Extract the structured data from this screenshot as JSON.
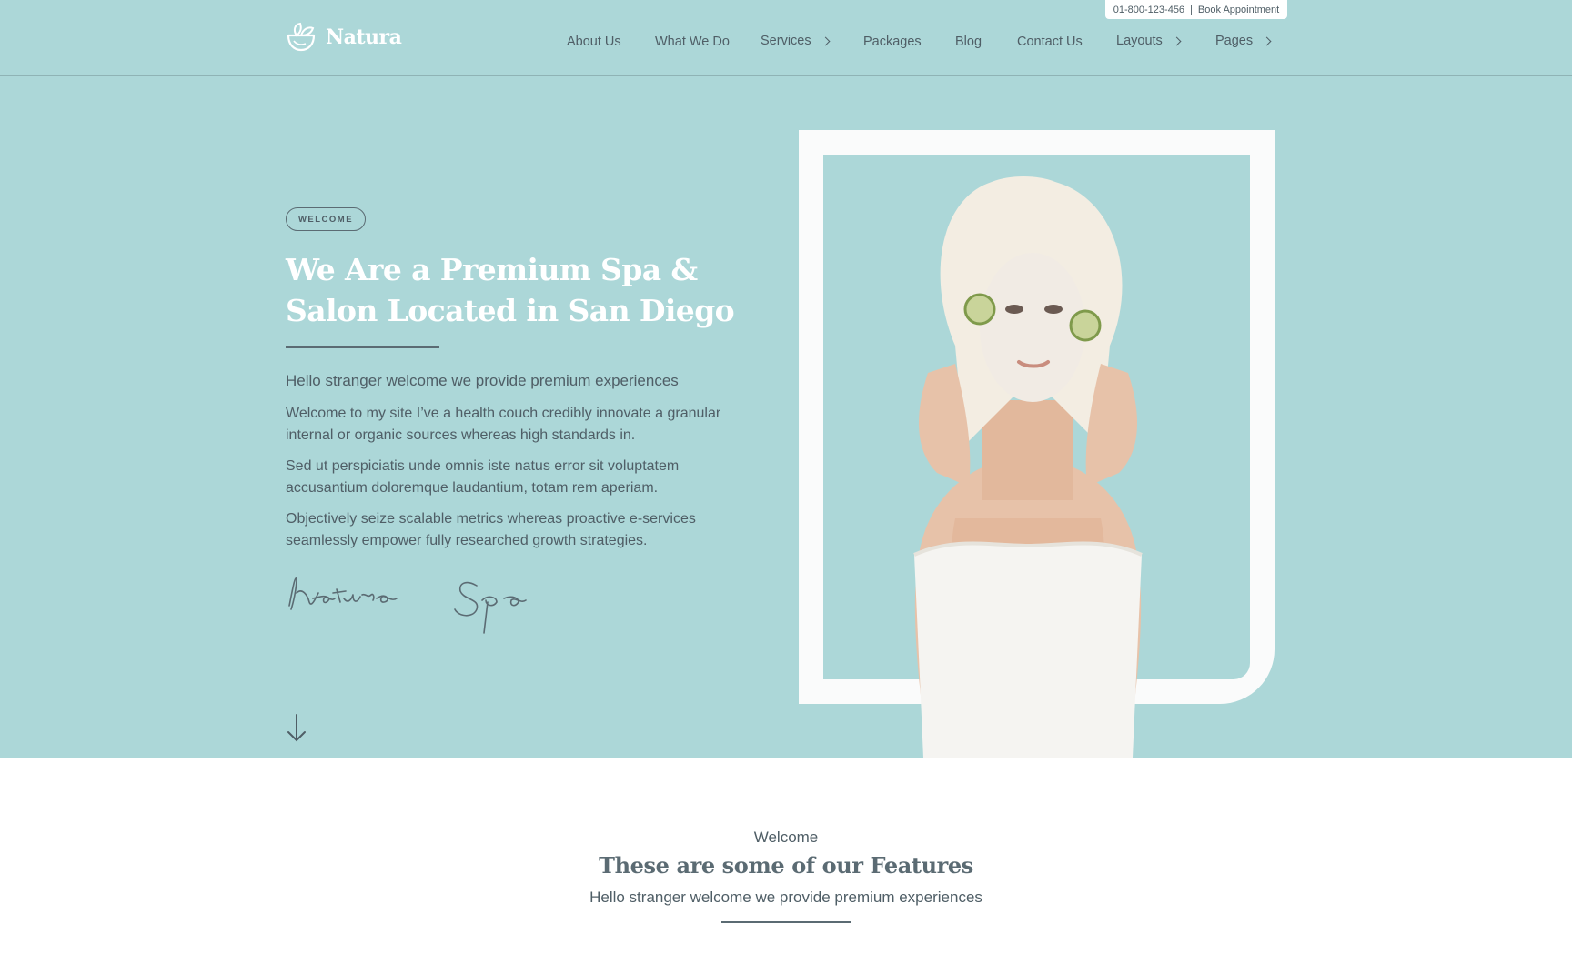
{
  "topbar": {
    "phone": "01-800-123-456",
    "separator": "|",
    "cta": "Book Appointment"
  },
  "brand": {
    "name": "Natura",
    "icon": "leaf-bowl-icon"
  },
  "nav": {
    "about": "About Us",
    "what_we_do": "What We Do",
    "services": "Services",
    "packages": "Packages",
    "blog": "Blog",
    "contact": "Contact Us",
    "layouts": "Layouts",
    "pages": "Pages"
  },
  "hero": {
    "badge": "WELCOME",
    "title": "We Are a Premium Spa & Salon Located in San Diego",
    "lead": "Hello stranger welcome we provide premium experiences",
    "paragraphs": [
      "Welcome to my site I’ve a health couch credibly innovate a granular internal or organic sources whereas high standards in.",
      "Sed ut perspiciatis unde omnis iste natus error sit voluptatem accusantium doloremque laudantium, totam rem aperiam.",
      "Objectively seize scalable metrics whereas proactive e-services seamlessly empower fully researched growth strategies."
    ],
    "signature": "Natura Spa",
    "scroll_icon": "arrow-down-icon"
  },
  "features": {
    "eyebrow": "Welcome",
    "title": "These are some of our Features",
    "subtitle": "Hello stranger welcome we provide premium experiences"
  },
  "colors": {
    "hero_bg": "#acd7d8",
    "text": "#4f5e66",
    "white": "#ffffff",
    "frame": "#fafbfb"
  }
}
